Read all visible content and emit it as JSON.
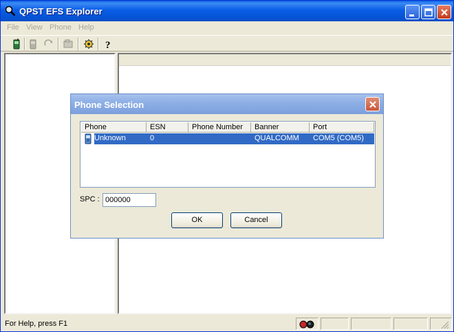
{
  "window": {
    "title": "QPST EFS Explorer",
    "icon": "magnifier-icon"
  },
  "menu": {
    "items": [
      "File",
      "View",
      "Phone",
      "Help"
    ]
  },
  "toolbar": {
    "icons": [
      "phone-icon",
      "phone-disabled-icon",
      "refresh-icon",
      "properties-icon",
      "settings-icon",
      "help-icon"
    ]
  },
  "status": {
    "text": "For Help, press F1"
  },
  "dialog": {
    "title": "Phone Selection",
    "columns": [
      "Phone",
      "ESN",
      "Phone Number",
      "Banner",
      "Port"
    ],
    "rows": [
      {
        "phone": "Unknown",
        "esn": "0",
        "phone_number": "",
        "banner": "QUALCOMM",
        "port": "COM5 (COM5)",
        "selected": true
      }
    ],
    "spc_label": "SPC :",
    "spc_value": "000000",
    "ok_label": "OK",
    "cancel_label": "Cancel"
  },
  "colors": {
    "titlebar": "#0554d6",
    "dialog_titlebar": "#8fb0e6",
    "selection": "#316ac5",
    "face": "#ece9d8"
  }
}
